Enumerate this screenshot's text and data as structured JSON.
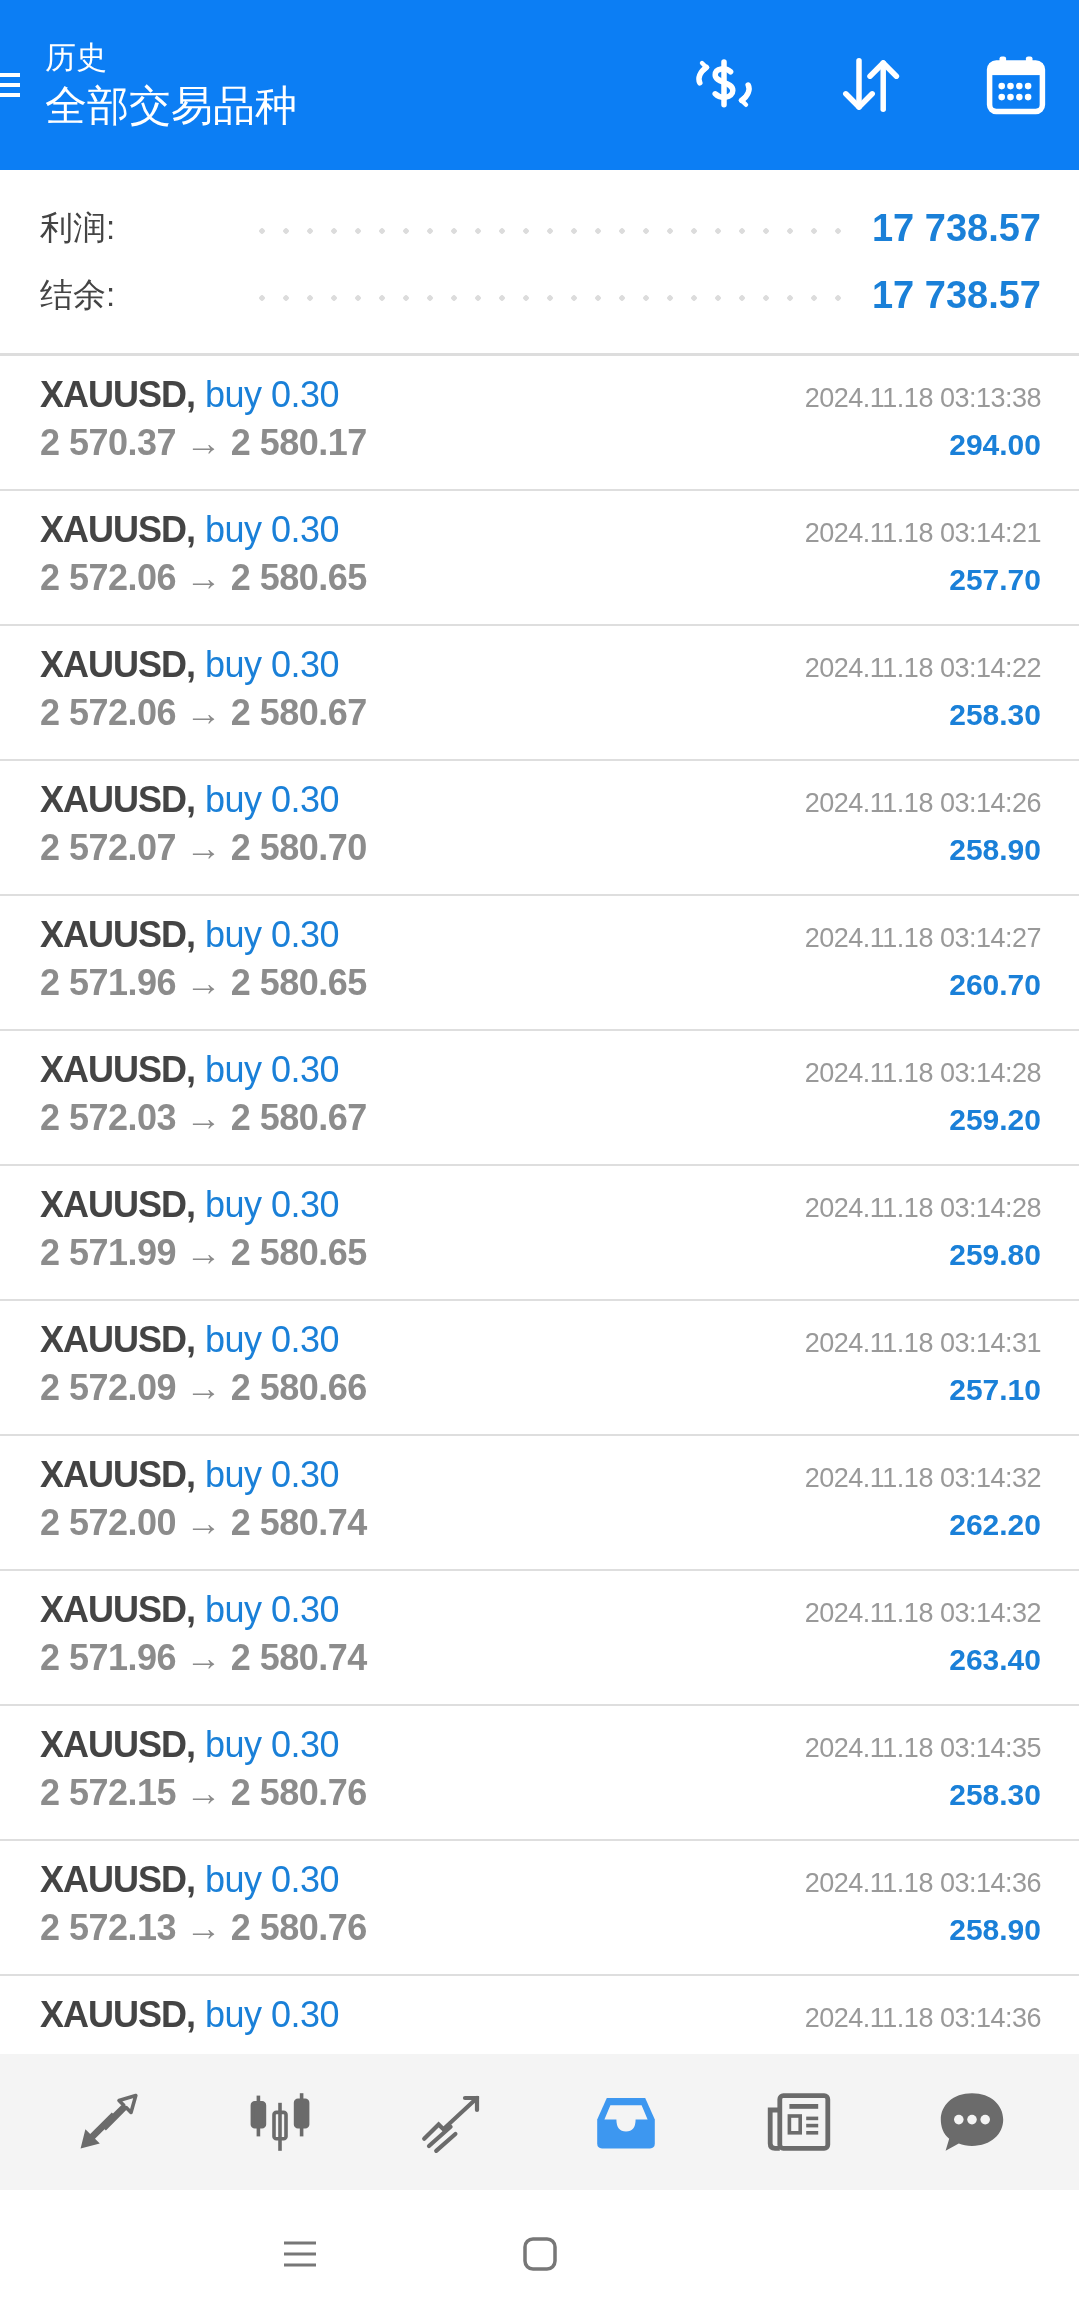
{
  "header": {
    "subtitle": "历史",
    "title": "全部交易品种"
  },
  "summary": [
    {
      "label": "利润:",
      "value": "17 738.57"
    },
    {
      "label": "结余:",
      "value": "17 738.57"
    }
  ],
  "deals": [
    {
      "symbol": "XAUUSD,",
      "side": "buy 0.30",
      "time": "2024.11.18 03:13:38",
      "prices": "2 570.37 → 2 580.17",
      "profit": "294.00"
    },
    {
      "symbol": "XAUUSD,",
      "side": "buy 0.30",
      "time": "2024.11.18 03:14:21",
      "prices": "2 572.06 → 2 580.65",
      "profit": "257.70"
    },
    {
      "symbol": "XAUUSD,",
      "side": "buy 0.30",
      "time": "2024.11.18 03:14:22",
      "prices": "2 572.06 → 2 580.67",
      "profit": "258.30"
    },
    {
      "symbol": "XAUUSD,",
      "side": "buy 0.30",
      "time": "2024.11.18 03:14:26",
      "prices": "2 572.07 → 2 580.70",
      "profit": "258.90"
    },
    {
      "symbol": "XAUUSD,",
      "side": "buy 0.30",
      "time": "2024.11.18 03:14:27",
      "prices": "2 571.96 → 2 580.65",
      "profit": "260.70"
    },
    {
      "symbol": "XAUUSD,",
      "side": "buy 0.30",
      "time": "2024.11.18 03:14:28",
      "prices": "2 572.03 → 2 580.67",
      "profit": "259.20"
    },
    {
      "symbol": "XAUUSD,",
      "side": "buy 0.30",
      "time": "2024.11.18 03:14:28",
      "prices": "2 571.99 → 2 580.65",
      "profit": "259.80"
    },
    {
      "symbol": "XAUUSD,",
      "side": "buy 0.30",
      "time": "2024.11.18 03:14:31",
      "prices": "2 572.09 → 2 580.66",
      "profit": "257.10"
    },
    {
      "symbol": "XAUUSD,",
      "side": "buy 0.30",
      "time": "2024.11.18 03:14:32",
      "prices": "2 572.00 → 2 580.74",
      "profit": "262.20"
    },
    {
      "symbol": "XAUUSD,",
      "side": "buy 0.30",
      "time": "2024.11.18 03:14:32",
      "prices": "2 571.96 → 2 580.74",
      "profit": "263.40"
    },
    {
      "symbol": "XAUUSD,",
      "side": "buy 0.30",
      "time": "2024.11.18 03:14:35",
      "prices": "2 572.15 → 2 580.76",
      "profit": "258.30"
    },
    {
      "symbol": "XAUUSD,",
      "side": "buy 0.30",
      "time": "2024.11.18 03:14:36",
      "prices": "2 572.13 → 2 580.76",
      "profit": "258.90"
    },
    {
      "symbol": "XAUUSD,",
      "side": "buy 0.30",
      "time": "2024.11.18 03:14:36"
    }
  ],
  "nav_tabs": [
    {
      "kind": "trade",
      "selected": false
    },
    {
      "kind": "chart",
      "selected": false
    },
    {
      "kind": "trend",
      "selected": false
    },
    {
      "kind": "history",
      "selected": true
    },
    {
      "kind": "news",
      "selected": false
    },
    {
      "kind": "chat",
      "selected": false
    }
  ]
}
